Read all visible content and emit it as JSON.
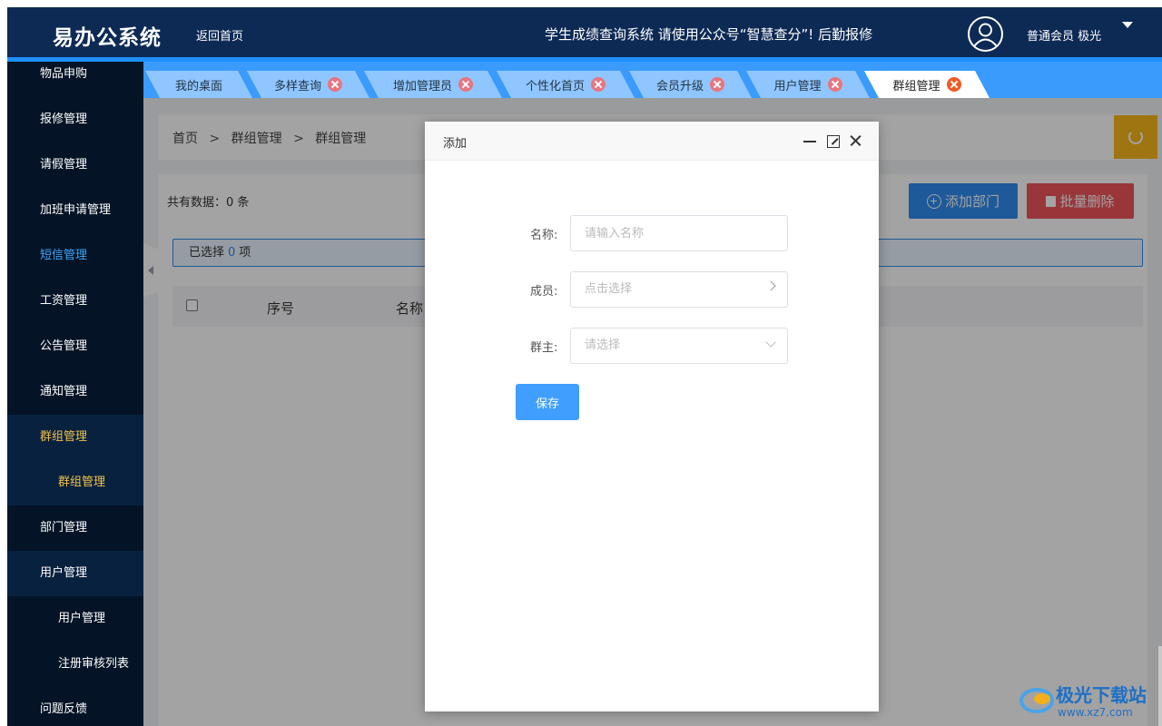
{
  "header": {
    "logo": "易办公系统",
    "home_link": "返回首页",
    "notice": "学生成绩查询系统 请使用公众号“智慧查分”! 后勤报修",
    "user": "普通会员 极光"
  },
  "sidebar": {
    "items": [
      {
        "label": "物品申购"
      },
      {
        "label": "报修管理"
      },
      {
        "label": "请假管理"
      },
      {
        "label": "加班申请管理"
      },
      {
        "label": "短信管理"
      },
      {
        "label": "工资管理"
      },
      {
        "label": "公告管理"
      },
      {
        "label": "通知管理"
      },
      {
        "label": "群组管理"
      },
      {
        "label": "群组管理"
      },
      {
        "label": "部门管理"
      },
      {
        "label": "用户管理"
      },
      {
        "label": "用户管理"
      },
      {
        "label": "注册审核列表"
      },
      {
        "label": "问题反馈"
      }
    ]
  },
  "tabs": [
    {
      "label": "我的桌面"
    },
    {
      "label": "多样查询"
    },
    {
      "label": "增加管理员"
    },
    {
      "label": "个性化首页"
    },
    {
      "label": "会员升级"
    },
    {
      "label": "用户管理"
    },
    {
      "label": "群组管理"
    }
  ],
  "breadcrumb": {
    "home": "首页",
    "sep1": ">",
    "level1": "群组管理",
    "sep2": ">",
    "level2": "群组管理"
  },
  "toolbar": {
    "total": "共有数据：0 条",
    "add_label": "添加部门",
    "delete_label": "批量删除"
  },
  "selection": {
    "prefix": "已选择",
    "count": "0",
    "suffix": "项"
  },
  "table": {
    "columns": [
      "序号",
      "名称"
    ]
  },
  "modal": {
    "title": "添加",
    "fields": {
      "name_label": "名称:",
      "name_placeholder": "请输入名称",
      "members_label": "成员:",
      "members_placeholder": "点击选择",
      "owner_label": "群主:",
      "owner_placeholder": "请选择"
    },
    "save_label": "保存"
  },
  "watermark": {
    "text": "极光下载站",
    "url": "www.xz7.com"
  },
  "colors": {
    "header_bg": "#0d2a55",
    "sidebar_bg": "#041426",
    "tabbar_bg": "#3a9bfc",
    "primary": "#409eff",
    "danger": "#f0555b",
    "active_tab_close": "#f05a24",
    "highlight_yellow": "#f2c04a",
    "highlight_blue": "#3ea6ff"
  },
  "icons": [
    "avatar-icon",
    "caret-down-icon",
    "close-icon",
    "refresh-icon",
    "plus-circle-icon",
    "trash-icon",
    "minimize-icon",
    "maximize-icon",
    "chevron-right-icon",
    "chevron-down-icon",
    "collapse-arrow-icon"
  ]
}
